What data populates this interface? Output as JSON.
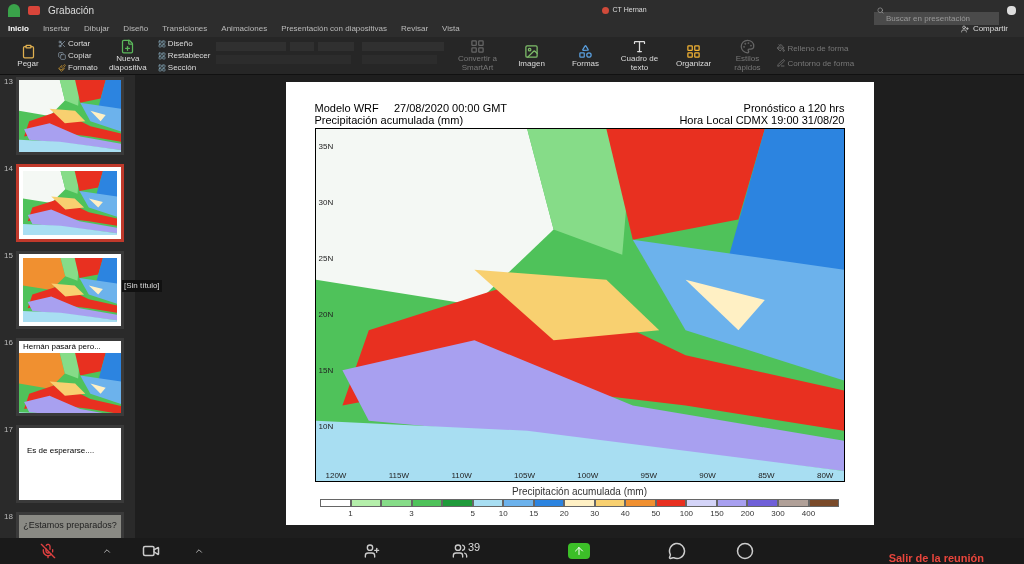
{
  "app": {
    "title": "Grabación",
    "document": "CT Hernan",
    "search_placeholder": "Buscar en presentación",
    "share": "Compartir"
  },
  "tabs": [
    {
      "label": "Inicio",
      "selected": true
    },
    {
      "label": "Insertar",
      "selected": false
    },
    {
      "label": "Dibujar",
      "selected": false
    },
    {
      "label": "Diseño",
      "selected": false
    },
    {
      "label": "Transiciones",
      "selected": false
    },
    {
      "label": "Animaciones",
      "selected": false
    },
    {
      "label": "Presentación con diapositivas",
      "selected": false
    },
    {
      "label": "Revisar",
      "selected": false
    },
    {
      "label": "Vista",
      "selected": false
    }
  ],
  "ribbon": {
    "paste": "Pegar",
    "clipboard": [
      "Cortar",
      "Copiar",
      "Formato"
    ],
    "new_slide": "Nueva diapositiva",
    "slide_items": [
      "Diseño",
      "Restablecer",
      "Sección"
    ],
    "insert": [
      {
        "label": "Convertir a SmartArt",
        "disabled": true
      },
      {
        "label": "Imagen",
        "disabled": false
      },
      {
        "label": "Formas",
        "disabled": false
      },
      {
        "label": "Cuadro de texto",
        "disabled": false
      },
      {
        "label": "Organizar",
        "disabled": false
      },
      {
        "label": "Estilos rápidos",
        "disabled": true
      }
    ],
    "shape_items": [
      "Relleno de forma",
      "Contorno de forma"
    ]
  },
  "thumbnails": [
    {
      "number": "13",
      "kind": "picture",
      "selected": false
    },
    {
      "number": "14",
      "kind": "map",
      "selected": true
    },
    {
      "number": "15",
      "kind": "map",
      "selected": false
    },
    {
      "number": "16",
      "kind": "titled",
      "title": "Hernán pasará pero...",
      "selected": false
    },
    {
      "number": "17",
      "kind": "text",
      "title": "Es de esperarse....",
      "selected": false
    },
    {
      "number": "18",
      "kind": "banner",
      "title": "¿Estamos preparados?",
      "selected": false
    }
  ],
  "tooltip": "[Sin título]",
  "slide": {
    "header_left": [
      "Modelo WRF     27/08/2020 00:00 GMT",
      "Precipitación acumulada (mm)"
    ],
    "header_right": [
      "Pronóstico a 120 hrs",
      "Hora Local CDMX 19:00 31/08/20"
    ],
    "lat_labels": [
      "35N",
      "30N",
      "25N",
      "20N",
      "15N",
      "10N"
    ],
    "lon_labels": [
      "120W",
      "115W",
      "110W",
      "105W",
      "100W",
      "95W",
      "90W",
      "85W",
      "80W"
    ],
    "legend_title": "Precipitación acumulada (mm)",
    "legend": [
      {
        "color": "#ffffff",
        "label": "1"
      },
      {
        "color": "#b4eeaa"
      },
      {
        "color": "#86dc88",
        "label": "3"
      },
      {
        "color": "#4fc25a"
      },
      {
        "color": "#1f9a3a",
        "label": "5"
      },
      {
        "color": "#a8def2",
        "label": "10"
      },
      {
        "color": "#6cb2ec",
        "label": "15"
      },
      {
        "color": "#2c84e0",
        "label": "20"
      },
      {
        "color": "#fff0c4",
        "label": "30"
      },
      {
        "color": "#f8d070",
        "label": "40"
      },
      {
        "color": "#f09030",
        "label": "50"
      },
      {
        "color": "#e83020",
        "label": "100"
      },
      {
        "color": "#d4d4f8",
        "label": "150"
      },
      {
        "color": "#a8a0f0",
        "label": "200"
      },
      {
        "color": "#7060d8",
        "label": "300"
      },
      {
        "color": "#b0a098",
        "label": "400"
      },
      {
        "color": "#7a4a2a"
      }
    ]
  },
  "meeting": {
    "mic_muted": true,
    "participants": "39",
    "leave": "Salir de la reunión"
  }
}
